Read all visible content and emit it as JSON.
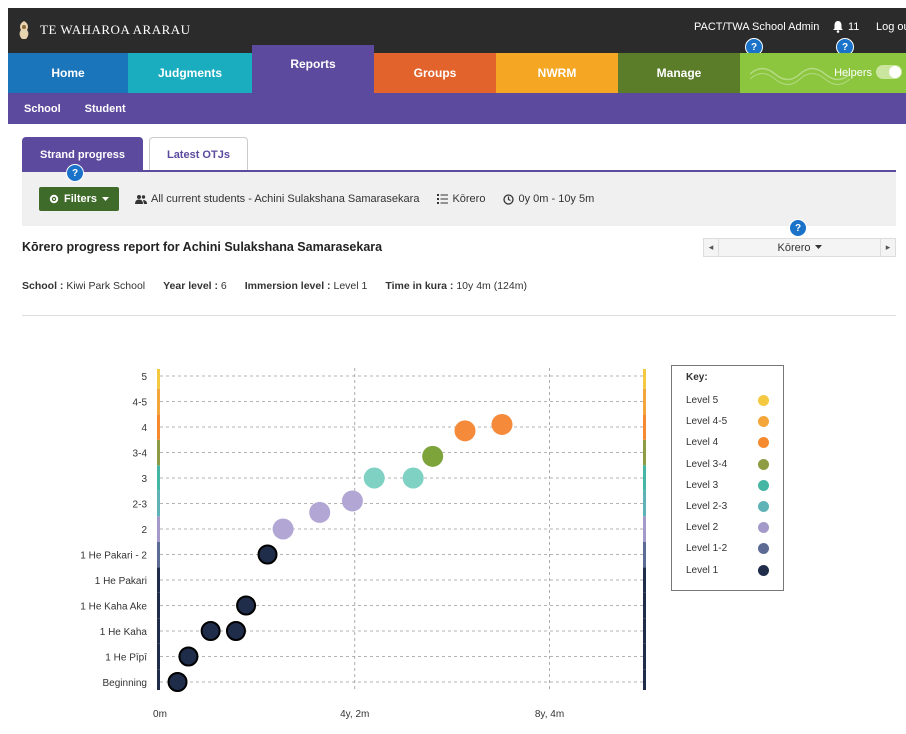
{
  "app": {
    "brand": "TE WAHAROA ARARAU",
    "admin_label": "PACT/TWA School Admin",
    "notification_count": "11",
    "logout_label": "Log out",
    "help_badge": "?"
  },
  "main_tabs": [
    {
      "label": "Home",
      "color": "#1b75bb"
    },
    {
      "label": "Judgments",
      "color": "#1aadc0"
    },
    {
      "label": "Reports",
      "color": "#5c4a9e"
    },
    {
      "label": "Groups",
      "color": "#e2632b"
    },
    {
      "label": "NWRM",
      "color": "#f5a623"
    },
    {
      "label": "Manage",
      "color": "#5b7d2a"
    }
  ],
  "helpers": {
    "label": "Helpers",
    "enabled": true
  },
  "sub_nav": [
    {
      "label": "School"
    },
    {
      "label": "Student"
    }
  ],
  "page_tabs": [
    {
      "label": "Strand progress",
      "active": true
    },
    {
      "label": "Latest OTJs",
      "active": false
    }
  ],
  "filters": {
    "button_label": "Filters",
    "students": "All current students - Achini Sulakshana Samarasekara",
    "strand": "Kōrero",
    "time_range": "0y 0m - 10y 5m"
  },
  "report": {
    "title": "Kōrero progress report for Achini Sulakshana Samarasekara",
    "selector_value": "Kōrero"
  },
  "student_info": {
    "school_label": "School :",
    "school": "Kiwi Park School",
    "year_label": "Year level :",
    "year": "6",
    "immersion_label": "Immersion level :",
    "immersion": "Level 1",
    "time_label": "Time in kura :",
    "time": "10y 4m (124m)"
  },
  "key": {
    "title": "Key:",
    "items": [
      {
        "label": "Level 5",
        "color": "#f5c842"
      },
      {
        "label": "Level 4-5",
        "color": "#f5a63a"
      },
      {
        "label": "Level 4",
        "color": "#f58a2e"
      },
      {
        "label": "Level 3-4",
        "color": "#8e9c44"
      },
      {
        "label": "Level 3",
        "color": "#45b5a4"
      },
      {
        "label": "Level 2-3",
        "color": "#5fb2b5"
      },
      {
        "label": "Level 2",
        "color": "#a49ac9"
      },
      {
        "label": "Level 1-2",
        "color": "#5c6b94"
      },
      {
        "label": "Level 1",
        "color": "#1f2d4a"
      }
    ]
  },
  "chart_data": {
    "type": "scatter",
    "y_categories": [
      "Beginning",
      "1 He Pīpī",
      "1 He Kaha",
      "1 He Kaha Ake",
      "1 He Pakari",
      "1 He Pakari - 2",
      "2",
      "2-3",
      "3",
      "3-4",
      "4",
      "4-5",
      "5"
    ],
    "x_ticks": [
      {
        "months": 0,
        "label": "0m"
      },
      {
        "months": 50,
        "label": "4y, 2m"
      },
      {
        "months": 100,
        "label": "8y, 4m"
      }
    ],
    "x_range_months": [
      0,
      124
    ],
    "grid": true,
    "legend_position": "right",
    "points": [
      {
        "x": 4.5,
        "level": 0,
        "key": 8,
        "face": "#1f2d4a"
      },
      {
        "x": 7.3,
        "level": 1,
        "key": 8,
        "face": "#1f2d4a"
      },
      {
        "x": 13.0,
        "level": 2,
        "key": 8,
        "face": "#1f2d4a"
      },
      {
        "x": 19.5,
        "level": 2,
        "key": 8,
        "face": "#1f2d4a"
      },
      {
        "x": 22.1,
        "level": 3,
        "key": 8,
        "face": "#1f2d4a"
      },
      {
        "x": 27.6,
        "level": 5,
        "key": 8,
        "face": "#1f2d4a"
      },
      {
        "x": 31.6,
        "level": 6,
        "key": 6,
        "face": "#b2a7d4"
      },
      {
        "x": 41.0,
        "level": 6.65,
        "key": 6,
        "face": "#b2a7d4"
      },
      {
        "x": 49.4,
        "level": 7.1,
        "key": 6,
        "face": "#b2a7d4"
      },
      {
        "x": 55.0,
        "level": 8,
        "key": 4,
        "face": "#7fd1c4"
      },
      {
        "x": 65.0,
        "level": 8,
        "key": 4,
        "face": "#7fd1c4"
      },
      {
        "x": 70.0,
        "level": 8.85,
        "key": 3,
        "face": "#7da43a"
      },
      {
        "x": 78.3,
        "level": 9.85,
        "key": 2,
        "face": "#f58a3a"
      },
      {
        "x": 87.8,
        "level": 10.1,
        "key": 2,
        "face": "#f58a3a"
      }
    ],
    "band_colors": [
      "#1f2d4a",
      "#1f2d4a",
      "#1f2d4a",
      "#1f2d4a",
      "#1f2d4a",
      "#5c6b94",
      "#a49ac9",
      "#5fb2b5",
      "#45b5a4",
      "#8e9c44",
      "#f58a2e",
      "#f5a63a",
      "#f5c842"
    ]
  }
}
